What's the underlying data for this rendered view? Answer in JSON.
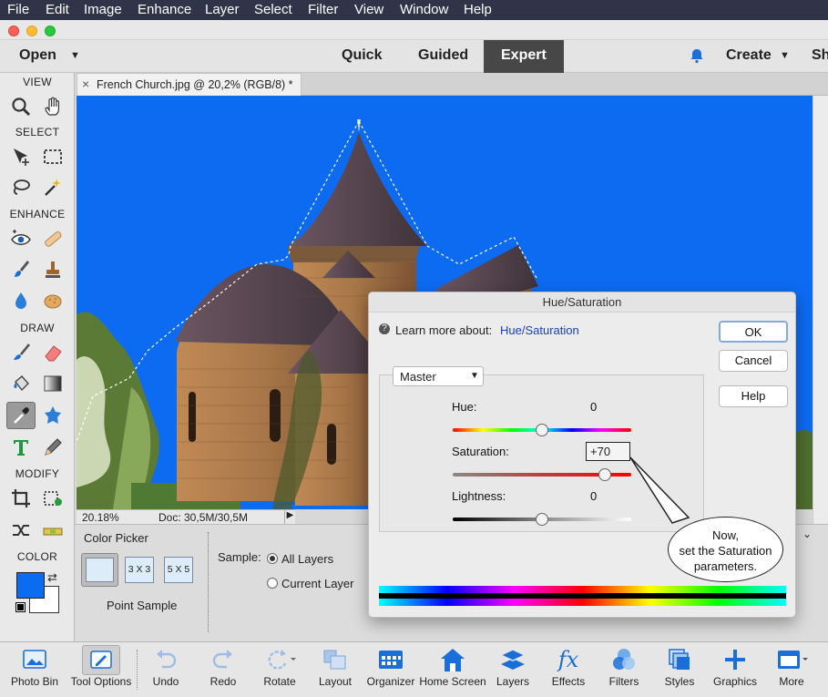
{
  "menu": {
    "items": [
      "File",
      "Edit",
      "Image",
      "Enhance",
      "Layer",
      "Select",
      "Filter",
      "View",
      "Window",
      "Help"
    ]
  },
  "modebar": {
    "open_label": "Open",
    "modes": [
      "Quick",
      "Guided",
      "Expert"
    ],
    "create_label": "Create",
    "share_label": "Sh"
  },
  "toolbox": {
    "sections": {
      "view": "VIEW",
      "select": "SELECT",
      "enhance": "ENHANCE",
      "draw": "DRAW",
      "modify": "MODIFY",
      "color": "COLOR"
    }
  },
  "document": {
    "tab_title": "French Church.jpg @ 20,2% (RGB/8) *",
    "close_glyph": "×",
    "zoom": "20.18%",
    "doc_size": "Doc: 30,5M/30,5M"
  },
  "options": {
    "tool_name": "Color Picker",
    "sizes": [
      "3 X 3",
      "5 X 5"
    ],
    "point_sample_label": "Point Sample",
    "sample_label": "Sample:",
    "all_layers": "All Layers",
    "current_layer": "Current Layer"
  },
  "dialog": {
    "title": "Hue/Saturation",
    "learn_more": "Learn more about:",
    "learn_link": "Hue/Saturation",
    "ok": "OK",
    "cancel": "Cancel",
    "help": "Help",
    "channel": "Master",
    "hue_label": "Hue:",
    "hue_value": "0",
    "saturation_label": "Saturation:",
    "saturation_value": "+70",
    "lightness_label": "Lightness:",
    "lightness_value": "0",
    "hue_pos": 0.5,
    "sat_pos": 0.85,
    "light_pos": 0.5
  },
  "callout": {
    "line1": "Now,",
    "line2": "set the Saturation",
    "line3": "parameters."
  },
  "taskbar": {
    "items": [
      "Photo Bin",
      "Tool Options",
      "Undo",
      "Redo",
      "Rotate",
      "Layout",
      "Organizer",
      "Home Screen",
      "Layers",
      "Effects",
      "Filters",
      "Styles",
      "Graphics",
      "More"
    ]
  },
  "colors": {
    "menubar": "#2f3448",
    "canvas_blue": "#0d6bf2",
    "foreground": "#0b6cf0",
    "background": "#ffffff",
    "link": "#1a3fb8"
  }
}
